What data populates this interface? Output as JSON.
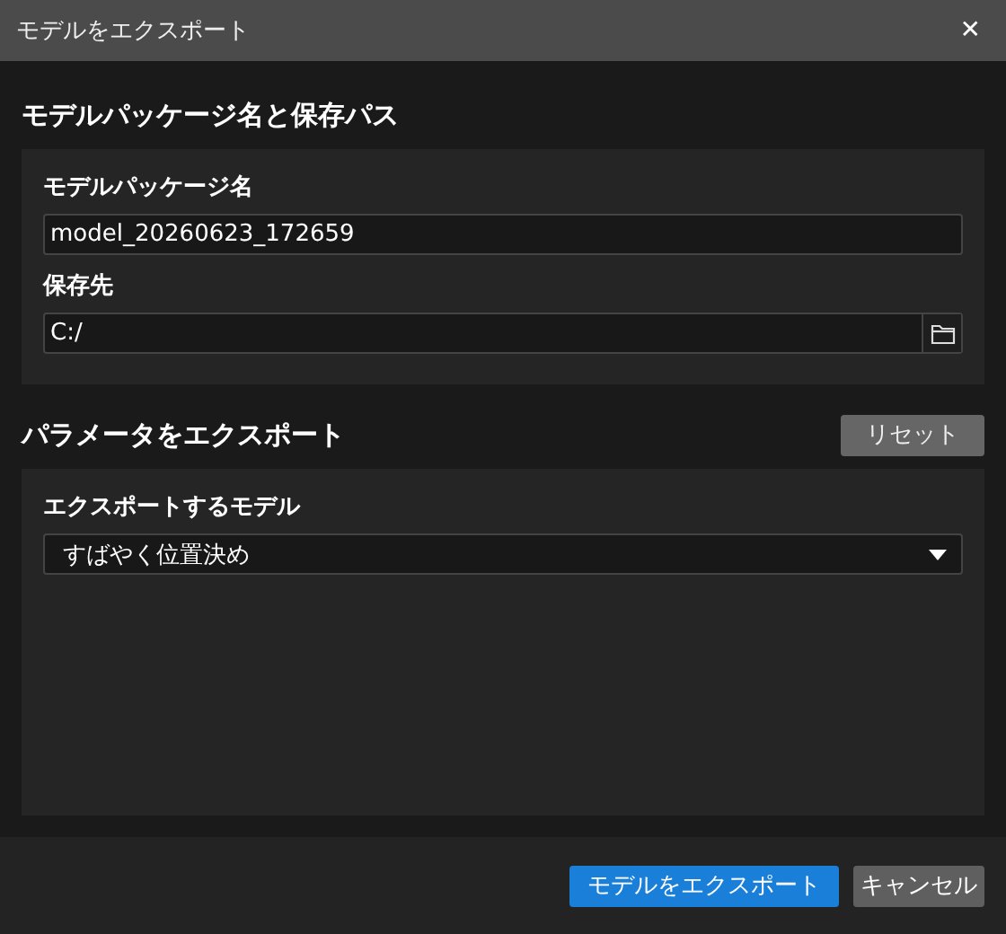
{
  "window": {
    "title": "モデルをエクスポート",
    "close": "✕"
  },
  "sections": [
    {
      "heading": "モデルパッケージ名と保存パス",
      "fields": [
        {
          "kind": "text",
          "label": "モデルパッケージ名",
          "value": "model_20260623_172659"
        },
        {
          "kind": "path",
          "label": "保存先",
          "value": "C:/"
        }
      ]
    },
    {
      "heading": "パラメータをエクスポート",
      "action": "リセット",
      "fields": [
        {
          "kind": "select",
          "label": "エクスポートするモデル",
          "value": "すばやく位置決め"
        }
      ]
    }
  ],
  "buttons": [
    {
      "label": "モデルをエクスポート",
      "primary": true
    },
    {
      "label": "キャンセル",
      "primary": false
    }
  ]
}
